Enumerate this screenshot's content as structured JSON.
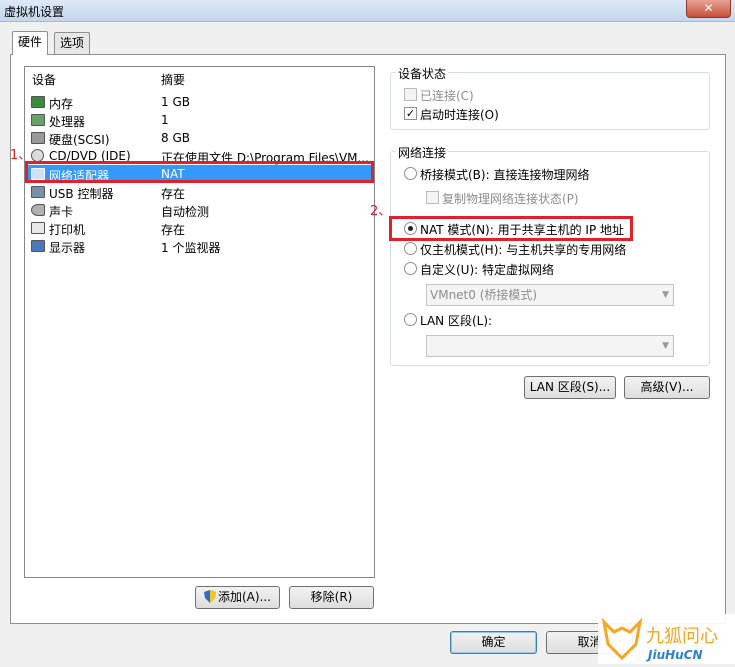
{
  "window": {
    "title": "虚拟机设置",
    "close_label": "✕"
  },
  "tabs": [
    {
      "label": "硬件"
    },
    {
      "label": "选项"
    }
  ],
  "device_list": {
    "headers": {
      "device": "设备",
      "summary": "摘要"
    },
    "rows": [
      {
        "device": "内存",
        "summary": "1 GB",
        "icon": "memory-icon"
      },
      {
        "device": "处理器",
        "summary": "1",
        "icon": "processor-icon"
      },
      {
        "device": "硬盘(SCSI)",
        "summary": "8 GB",
        "icon": "hard-disk-icon"
      },
      {
        "device": "CD/DVD (IDE)",
        "summary": "正在使用文件 D:\\Program Files\\VM...",
        "icon": "cd-dvd-icon"
      },
      {
        "device": "网络适配器",
        "summary": "NAT",
        "icon": "network-adapter-icon"
      },
      {
        "device": "USB 控制器",
        "summary": "存在",
        "icon": "usb-icon"
      },
      {
        "device": "声卡",
        "summary": "自动检测",
        "icon": "sound-card-icon"
      },
      {
        "device": "打印机",
        "summary": "存在",
        "icon": "printer-icon"
      },
      {
        "device": "显示器",
        "summary": "1 个监视器",
        "icon": "display-icon"
      }
    ]
  },
  "annotations": {
    "step1": "1、",
    "step2": "2、"
  },
  "device_status": {
    "title": "设备状态",
    "connected": "已连接(C)",
    "connect_on_start": "启动时连接(O)"
  },
  "network": {
    "title": "网络连接",
    "bridged": "桥接模式(B): 直接连接物理网络",
    "replicate": "复制物理网络连接状态(P)",
    "nat": "NAT 模式(N): 用于共享主机的 IP 地址",
    "host_only": "仅主机模式(H): 与主机共享的专用网络",
    "custom": "自定义(U): 特定虚拟网络",
    "custom_value": "VMnet0 (桥接模式)",
    "lan": "LAN 区段(L):"
  },
  "buttons": {
    "lan_segments": "LAN 区段(S)...",
    "advanced": "高级(V)...",
    "add": "添加(A)...",
    "remove": "移除(R)",
    "ok": "确定",
    "cancel": "取消"
  },
  "watermark": {
    "cn": "九狐问心",
    "en": "JiuHuCN"
  },
  "colors": {
    "selection": "#3399ff",
    "highlight": "#e0202a",
    "watermark": "#f5a623"
  }
}
